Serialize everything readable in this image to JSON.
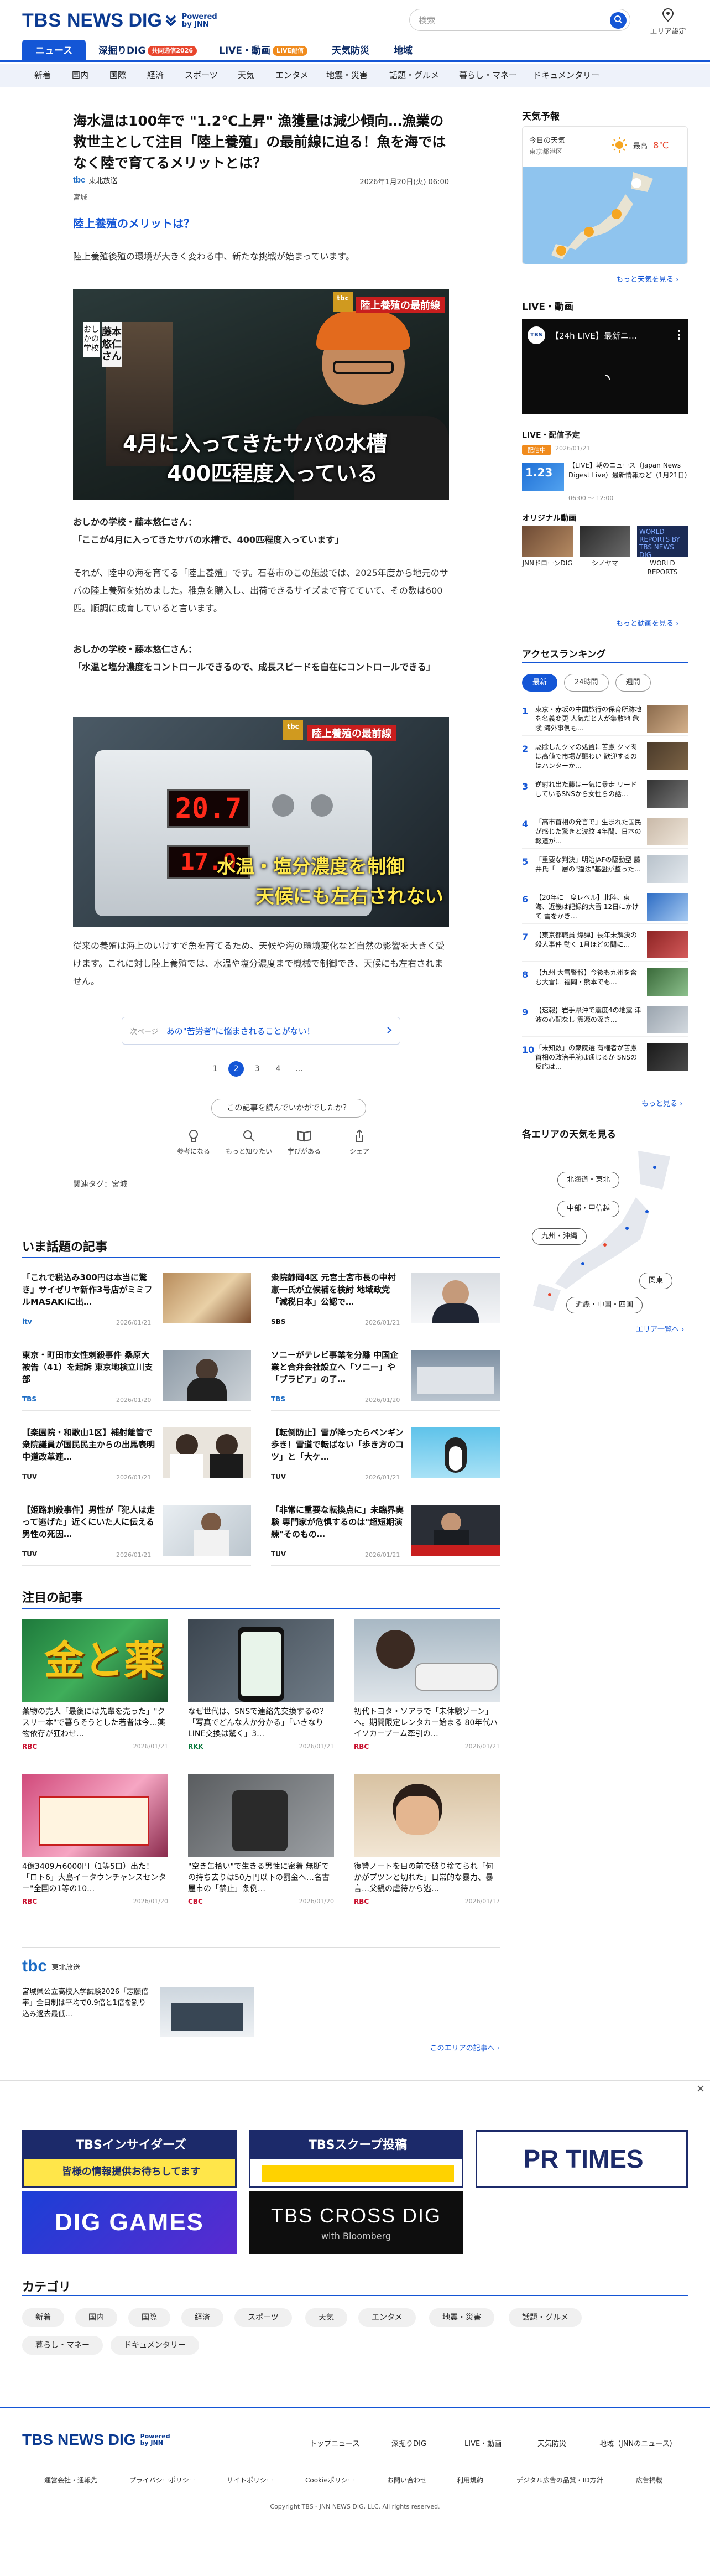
{
  "header": {
    "logo_tbs": "TBS",
    "logo_news": "NEWS DIG",
    "logo_powered": "Powered",
    "logo_by": "by JNN",
    "search_placeholder": "検索",
    "area_setting": "エリア設定"
  },
  "nav": {
    "items": [
      {
        "label": "ニュース"
      },
      {
        "label": "深掘りDIG",
        "badge": "共同通信2026"
      },
      {
        "label": "LIVE・動画",
        "badge": "LIVE配信"
      },
      {
        "label": "天気防災"
      },
      {
        "label": "地域"
      }
    ],
    "sub": [
      "新着",
      "国内",
      "国際",
      "経済",
      "スポーツ",
      "天気",
      "エンタメ",
      "地震・災害",
      "話題・グルメ",
      "暮らし・マネー",
      "ドキュメンタリー"
    ]
  },
  "article": {
    "title": "海水温は100年で \"1.2℃上昇\" 漁獲量は減少傾向…漁業の救世主として注目「陸上養殖」の最前線に迫る！魚を海ではなく陸で育てるメリットとは？",
    "source_logo": "tbc",
    "source": "東北放送",
    "date": "2026年1月20日(火) 06:00",
    "region": "宮城",
    "heading": "陸上養殖のメリットは？",
    "p1": "陸上養殖後殖の環境が大きく変わる中、新たな挑戦が始まっています。",
    "photo1": {
      "tag": "陸上養殖の最前線",
      "vertical_label": "おしかの学校",
      "name_label": "藤本悠仁さん",
      "caption_line1": "4月に入ってきたサバの水槽",
      "caption_line2": "400匹程度入っている"
    },
    "q1_speaker": "おしかの学校・藤本悠仁さん：",
    "q1": "「ここが4月に入ってきたサバの水槽で、400匹程度入っています」",
    "p2": "それが、陸中の海を育てる「陸上養殖」です。石巻市のこの施設では、2025年度から地元のサバの陸上養殖を始めました。稚魚を購入し、出荷できるサイズまで育てていて、その数は600匹。順調に成育していると言います。",
    "q2_speaker": "おしかの学校・藤本悠仁さん：",
    "q2": "「水温と塩分濃度をコントロールできるので、成長スピードを自在にコントロールできる」",
    "photo2": {
      "tag": "陸上養殖の最前線",
      "display_1": "20.7",
      "display_2": "17.0",
      "caption_line1": "水温・塩分濃度を制御",
      "caption_line2": "天候にも左右されない"
    },
    "p3": "従来の養殖は海上のいけすで魚を育てるため、天候や海の環境変化など自然の影響を大きく受けます。これに対し陸上養殖では、水温や塩分濃度まで機械で制御でき、天候にも左右されません。",
    "prev_next_label": "次ページ",
    "prev_next_title": "あの\"苦労者\"に悩まされることがない！",
    "pages": [
      "1",
      "2",
      "3",
      "4",
      "…"
    ],
    "reaction_question": "この記事を読んでいかがでしたか？",
    "reactions": [
      "参考になる",
      "もっと知りたい",
      "学びがある",
      "シェア"
    ],
    "related_tags": "関連タグ：宮城"
  },
  "trending": {
    "title": "いま話題の記事",
    "items": [
      {
        "title": "「これで税込み300円は本当に驚き」サイゼリヤ新作3号店がミミフルMASAKIに出…",
        "src": "itv",
        "date": "2026/01/21"
      },
      {
        "title": "衆院静岡4区 元宮士宮市長の中村憲一氏が立候補を検討 地域政党「減税日本」公認で…",
        "src": "SBS",
        "date": "2026/01/21"
      },
      {
        "title": "東京・町田市女性刺殺事件 桑原大被告（41）を起訴 東京地検立川支部",
        "src": "TBS",
        "date": "2026/01/20"
      },
      {
        "title": "ソニーがテレビ事業を分離 中国企業と合弁会社設立へ「ソニー」や「ブラビア」の了…",
        "src": "TBS",
        "date": "2026/01/20"
      },
      {
        "title": "【楽園院・和歌山1区】補射離管で衆院議員が国民民主からの出馬表明 中道改革連…",
        "src": "TUV",
        "date": "2026/01/21"
      },
      {
        "title": "【転倒防止】雪が降ったらペンギン歩き！雪道で転ばない「歩き方のコツ」と「大ケ…",
        "src": "TUV",
        "date": "2026/01/21"
      },
      {
        "title": "【姫路刺殺事件】男性が「犯人は走って逃げた」近くにいた人に伝える 男性の死因…",
        "src": "TUV",
        "date": "2026/01/21"
      },
      {
        "title": "「非常に重要な転換点に」未臨界実験 専門家が危惧するのは\"超短期演練\"そのもの…",
        "src": "TUV",
        "date": "2026/01/21"
      }
    ]
  },
  "featured": {
    "title": "注目の記事",
    "items": [
      {
        "title": "薬物の売人「最後には先輩を売った」\"クスリ一本\"で暮らそうとした若者は今…薬物依存が狂わせ…",
        "src": "RBC",
        "date": "2026/01/21",
        "thumb_text": "金と薬物"
      },
      {
        "title": "なぜ世代は、SNSで連絡先交換するの？「写真でどんな人か分かる」「いきなりLINE交換は驚く」3…",
        "src": "RKK",
        "date": "2026/01/21"
      },
      {
        "title": "初代トヨタ・ソアラで「未体験ゾーン」へ。期間限定レンタカー始まる 80年代ハイソカーブーム牽引の…",
        "src": "RBC",
        "date": "2026/01/21"
      },
      {
        "title": "4億3409万6000円（1等5口）出た！「ロト6」大島イータウンチャンスセンター\"全国の1等の10…",
        "src": "RBC",
        "date": "2026/01/20"
      },
      {
        "title": "\"空き缶拾い\"で生きる男性に密着 無断での持ち去りは50万円以下の罰金へ…名古屋市の「禁止」条例…",
        "src": "CBC",
        "date": "2026/01/20"
      },
      {
        "title": "復讐ノートを目の前で破り捨てられ「何かがプツンと切れた」日常的な暴力、暴言…父親の虐待から逃…",
        "src": "RBC",
        "date": "2026/01/17"
      }
    ]
  },
  "local_block": {
    "logo": "tbc",
    "name": "東北放送",
    "item_title": "宮城県公立高校入学試験2026「志願倍率」全日制は平均で0.9倍と1倍を割り込み過去最低…",
    "more": "このエリアの記事へ ›"
  },
  "sidebar": {
    "weather": {
      "title": "天気予報",
      "today_label": "今日の天気",
      "region": "東京都港区",
      "high_label": "最高",
      "high_temp": "8℃",
      "more": "もっと天気を見る ›"
    },
    "live": {
      "title": "LIVE・動画",
      "video_title": "【24h LIVE】最新ニ…",
      "schedule_title": "LIVE・配信予定",
      "schedule_badge": "配信中",
      "schedule_date": "2026/01/21",
      "schedule_text": "【LIVE】朝のニュース（Japan News Digest Live）最新情報など（1月21日）",
      "schedule_time": "06:00 ～ 12:00",
      "original_title": "オリジナル動画",
      "originals": [
        {
          "label": "JNNドローンDIG"
        },
        {
          "label": "シノヤマ"
        },
        {
          "label": "WORLD REPORTS"
        }
      ],
      "world_reports": "WORLD REPORTS BY TBS NEWS DIG",
      "more": "もっと動画を見る ›"
    },
    "ranking": {
      "title": "アクセスランキング",
      "tabs": [
        "最新",
        "24時間",
        "週間"
      ],
      "items": [
        {
          "n": "1",
          "text": "東京・赤坂の中国旅行の保育所跡地を名義変更 人気だと人が集散地 危険 海外事例も…"
        },
        {
          "n": "2",
          "text": "駆除したクマの処置に苦慮 クマ肉は高値で市場が賑わい 歓迎するのはハンターか…"
        },
        {
          "n": "3",
          "text": "逆射れ出た藤は一気に暴走 リードしているSNSから女性らの話…"
        },
        {
          "n": "4",
          "text": "「高市首相の発言で」生まれた国民が感じた驚きと波紋 4年間、日本の報道が…"
        },
        {
          "n": "5",
          "text": "「重要な判決」明治JAFの駆動型 藤井氏「一層の\"違法\"基盤が整った…"
        },
        {
          "n": "6",
          "text": "【20年に一度レベル】北陸、東海、近畿は記録的大雪 12日にかけて 雪をかき…"
        },
        {
          "n": "7",
          "text": "【東京都職員 爆弾】長年未解決の殺人事件 動く 1月ほどの間に…"
        },
        {
          "n": "8",
          "text": "【九州 大雪警報】今後も九州を含む大雪に 福岡・熊本でも…"
        },
        {
          "n": "9",
          "text": "【速報】岩手県沖で震度4の地震 津波の心配なし 震源の深さ…"
        },
        {
          "n": "10",
          "text": "「未知数」の衆院選 有権者が苦慮 首相の政治手腕は通じるか SNSの反応は…"
        }
      ],
      "more": "もっと見る ›"
    },
    "areas": {
      "title": "各エリアの天気を見る",
      "pills": [
        "北海道・東北",
        "中部・甲信越",
        "九州・沖縄",
        "関東",
        "近畿・中国・四国"
      ],
      "more": "エリア一覧へ ›"
    }
  },
  "banners": {
    "b1": "TBSインサイダーズ",
    "b1_sub": "皆様の情報提供お待ちしてます",
    "b2": "TBSスクープ投稿",
    "b3": "PR TIMES",
    "b4": "DIG GAMES",
    "b5_main": "TBS CROSS DIG",
    "b5_sub": "with Bloomberg"
  },
  "categories": {
    "title": "カテゴリ",
    "items": [
      "新着",
      "国内",
      "国際",
      "経済",
      "スポーツ",
      "天気",
      "エンタメ",
      "地震・災害",
      "話題・グルメ",
      "暮らし・マネー",
      "ドキュメンタリー"
    ]
  },
  "footer": {
    "links": [
      "トップニュース",
      "深掘りDIG",
      "LIVE・動画",
      "天気防災",
      "地域（JNNのニュース）"
    ],
    "small": [
      "運営会社・通報先",
      "プライバシーポリシー",
      "サイトポリシー",
      "Cookieポリシー",
      "お問い合わせ",
      "利用規約",
      "デジタル広告の品質・ID方針",
      "広告掲載"
    ],
    "copyright": "Copyright TBS - JNN NEWS DIG, LLC. All rights reserved."
  }
}
